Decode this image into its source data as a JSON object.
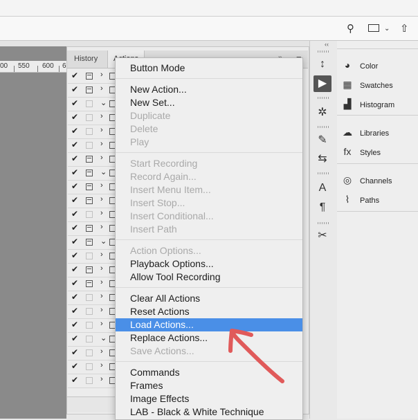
{
  "toolbar": {
    "search_icon": "search-icon",
    "workspace_icon": "workspace-icon",
    "workspace_chevron": "chevron-down-icon",
    "share_icon": "share-icon"
  },
  "ruler": {
    "ticks": [
      "00",
      "550",
      "600",
      "6"
    ]
  },
  "panel": {
    "tabs": [
      "History",
      "Actions"
    ],
    "collapse_glyph": "»",
    "menu_glyph": "≡"
  },
  "menu": {
    "groups": [
      [
        {
          "label": "Button Mode",
          "enabled": true
        }
      ],
      [
        {
          "label": "New Action...",
          "enabled": true
        },
        {
          "label": "New Set...",
          "enabled": true
        },
        {
          "label": "Duplicate",
          "enabled": false
        },
        {
          "label": "Delete",
          "enabled": false
        },
        {
          "label": "Play",
          "enabled": false
        }
      ],
      [
        {
          "label": "Start Recording",
          "enabled": false
        },
        {
          "label": "Record Again...",
          "enabled": false
        },
        {
          "label": "Insert Menu Item...",
          "enabled": false
        },
        {
          "label": "Insert Stop...",
          "enabled": false
        },
        {
          "label": "Insert Conditional...",
          "enabled": false
        },
        {
          "label": "Insert Path",
          "enabled": false
        }
      ],
      [
        {
          "label": "Action Options...",
          "enabled": false
        },
        {
          "label": "Playback Options...",
          "enabled": true
        },
        {
          "label": "Allow Tool Recording",
          "enabled": true
        }
      ],
      [
        {
          "label": "Clear All Actions",
          "enabled": true
        },
        {
          "label": "Reset Actions",
          "enabled": true
        },
        {
          "label": "Load Actions...",
          "enabled": true,
          "highlighted": true
        },
        {
          "label": "Replace Actions...",
          "enabled": true
        },
        {
          "label": "Save Actions...",
          "enabled": false
        }
      ],
      [
        {
          "label": "Commands",
          "enabled": true
        },
        {
          "label": "Frames",
          "enabled": true
        },
        {
          "label": "Image Effects",
          "enabled": true
        },
        {
          "label": "LAB - Black & White Technique",
          "enabled": true
        }
      ]
    ]
  },
  "right_panels": [
    [
      {
        "label": "Color",
        "icon": "color-icon",
        "glyph": "◕"
      },
      {
        "label": "Swatches",
        "icon": "swatches-icon",
        "glyph": "▦"
      },
      {
        "label": "Histogram",
        "icon": "histogram-icon",
        "glyph": "▟"
      }
    ],
    [
      {
        "label": "Libraries",
        "icon": "libraries-icon",
        "glyph": "☁"
      },
      {
        "label": "Styles",
        "icon": "styles-icon",
        "glyph": "fx"
      }
    ],
    [
      {
        "label": "Channels",
        "icon": "channels-icon",
        "glyph": "◎"
      },
      {
        "label": "Paths",
        "icon": "paths-icon",
        "glyph": "⌇"
      }
    ]
  ],
  "strip_icons": [
    {
      "name": "history-icon",
      "glyph": "↕"
    },
    {
      "name": "actions-play-icon",
      "glyph": "▶"
    },
    {
      "name": "navigator-icon",
      "glyph": "✲"
    },
    {
      "name": "brushes-icon",
      "glyph": "✎"
    },
    {
      "name": "adjustments-icon",
      "glyph": "⇆"
    },
    {
      "name": "character-icon",
      "glyph": "A"
    },
    {
      "name": "paragraph-icon",
      "glyph": "¶"
    },
    {
      "name": "tools-icon",
      "glyph": "✂"
    }
  ],
  "action_rows": [
    {
      "checked": true,
      "dialog": true,
      "expand": "›"
    },
    {
      "checked": true,
      "dialog": true,
      "expand": "›"
    },
    {
      "checked": true,
      "dialog": false,
      "expand": "⌄"
    },
    {
      "checked": true,
      "dialog": false,
      "expand": "›"
    },
    {
      "checked": true,
      "dialog": false,
      "expand": "›"
    },
    {
      "checked": true,
      "dialog": false,
      "expand": "›"
    },
    {
      "checked": true,
      "dialog": true,
      "expand": "›"
    },
    {
      "checked": true,
      "dialog": true,
      "expand": "⌄"
    },
    {
      "checked": true,
      "dialog": true,
      "expand": "›"
    },
    {
      "checked": true,
      "dialog": true,
      "expand": "›"
    },
    {
      "checked": true,
      "dialog": false,
      "expand": "›"
    },
    {
      "checked": true,
      "dialog": true,
      "expand": "›"
    },
    {
      "checked": true,
      "dialog": true,
      "expand": "⌄"
    },
    {
      "checked": true,
      "dialog": false,
      "expand": "›"
    },
    {
      "checked": true,
      "dialog": true,
      "expand": "›"
    },
    {
      "checked": true,
      "dialog": true,
      "expand": "›"
    },
    {
      "checked": true,
      "dialog": false,
      "expand": "›"
    },
    {
      "checked": true,
      "dialog": false,
      "expand": "›"
    },
    {
      "checked": true,
      "dialog": false,
      "expand": "›"
    },
    {
      "checked": true,
      "dialog": false,
      "expand": "⌄"
    },
    {
      "checked": true,
      "dialog": false,
      "expand": "›"
    },
    {
      "checked": true,
      "dialog": false,
      "expand": "›"
    },
    {
      "checked": true,
      "dialog": false,
      "expand": "›"
    }
  ],
  "annotation": {
    "type": "hand-drawn arrow",
    "color": "#e05a5a"
  }
}
